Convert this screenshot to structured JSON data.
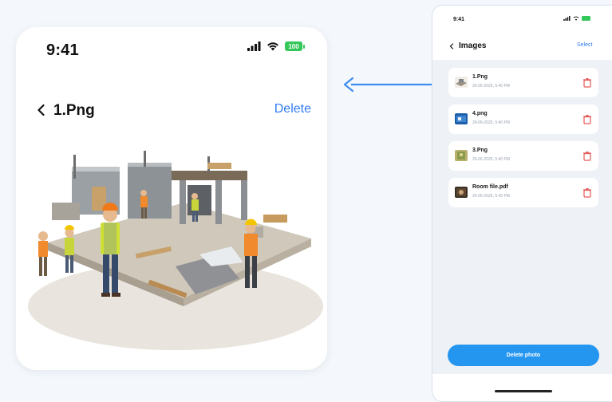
{
  "detail": {
    "status_time": "9:41",
    "battery": "100",
    "title": "1.Png",
    "delete_label": "Delete"
  },
  "list_screen": {
    "status_time": "9:41",
    "title": "Images",
    "select_label": "Select",
    "items": [
      {
        "name": "1.Png",
        "date": "26-06-2025, 5:40 PM"
      },
      {
        "name": "4.png",
        "date": "26-06-2025, 5:40 PM"
      },
      {
        "name": "3.Png",
        "date": "26-06-2025, 5:40 PM"
      },
      {
        "name": "Room file.pdf",
        "date": "26-06-2025, 5:40 PM"
      }
    ],
    "cta_label": "Delete photo"
  },
  "colors": {
    "accent": "#2f7cf6",
    "cta": "#2596f0",
    "delete_icon": "#e45757",
    "battery": "#34c759"
  },
  "icons": [
    "back-chevron-icon",
    "signal-icon",
    "wifi-icon",
    "battery-icon",
    "trash-icon",
    "arrow-left-icon"
  ]
}
